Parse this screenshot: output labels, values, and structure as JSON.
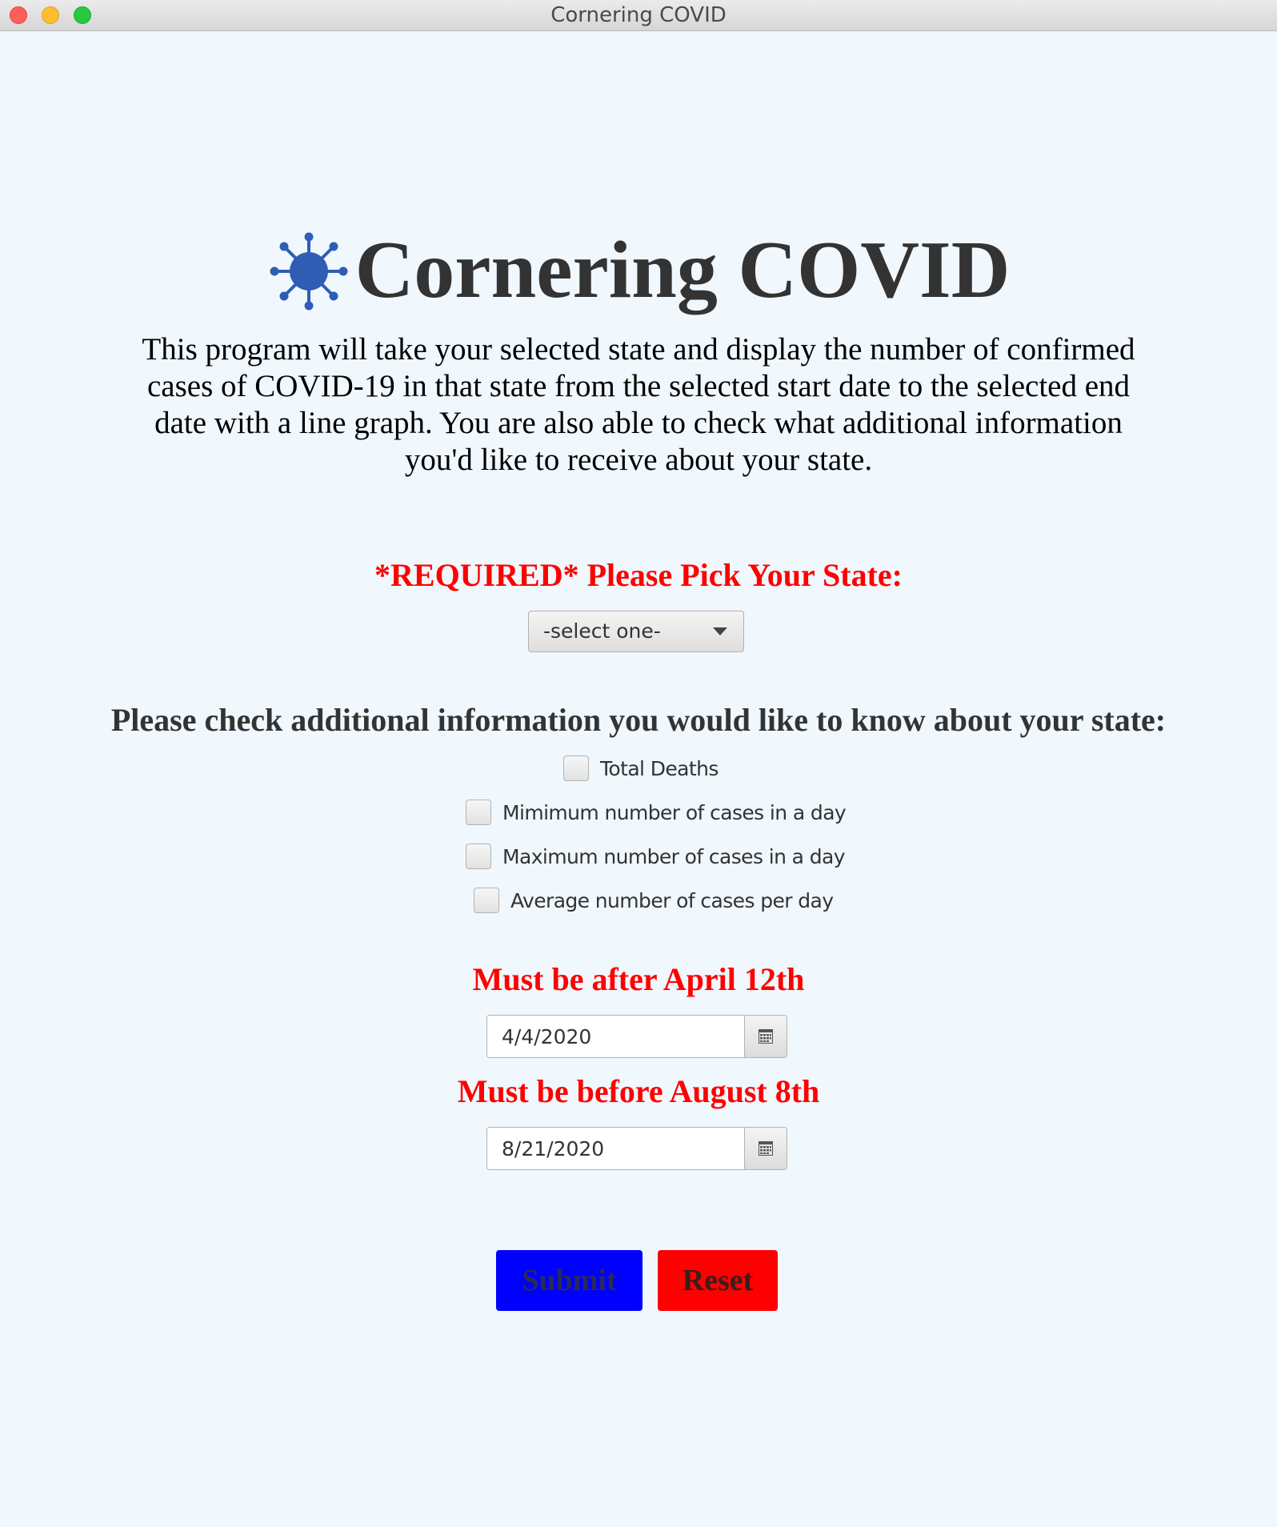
{
  "window": {
    "title": "Cornering COVID"
  },
  "header": {
    "title": "Cornering COVID",
    "description": "This program will take your selected state and display the number of confirmed cases of COVID-19 in that state from the selected start date to the selected end date with a line graph. You are also able to check what additional information you'd like to receive about your state.",
    "icon": "virus-icon"
  },
  "state": {
    "label": "*REQUIRED* Please Pick Your State:",
    "selected": "-select one-"
  },
  "additional": {
    "label": "Please check additional information you would like to know about your state:",
    "options": [
      {
        "label": "Total Deaths",
        "checked": false
      },
      {
        "label": "Mimimum number of cases in a day",
        "checked": false
      },
      {
        "label": "Maximum number of cases in a day",
        "checked": false
      },
      {
        "label": "Average number of cases per day",
        "checked": false
      }
    ]
  },
  "dates": {
    "start_note": "Must be after April 12th",
    "start_value": "4/4/2020",
    "end_note": "Must be before August 8th",
    "end_value": "8/21/2020"
  },
  "actions": {
    "submit_label": "Submit",
    "reset_label": "Reset"
  },
  "colors": {
    "background": "#f0f7fd",
    "accent_red": "#ff0000",
    "submit_blue": "#0000ff",
    "virus_blue": "#2f5db5"
  }
}
